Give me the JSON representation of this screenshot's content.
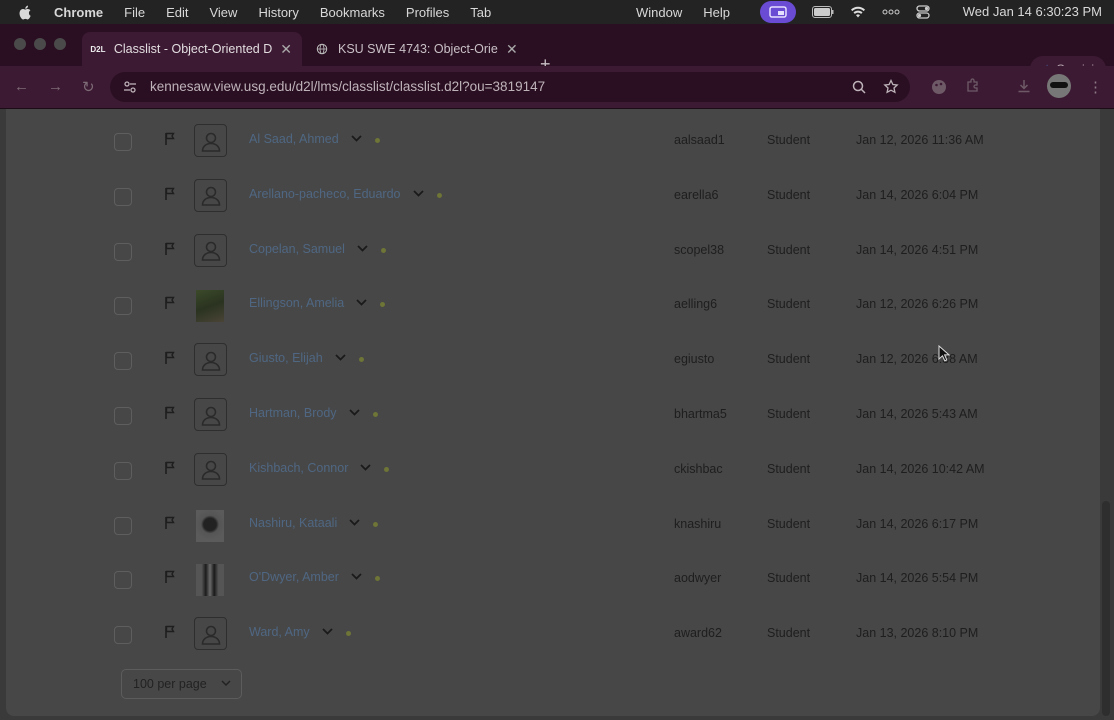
{
  "menubar": {
    "app": "Chrome",
    "items": [
      "File",
      "Edit",
      "View",
      "History",
      "Bookmarks",
      "Profiles",
      "Tab"
    ],
    "right_items": [
      "Window",
      "Help"
    ],
    "clock": "Wed Jan 14  6:30:23 PM"
  },
  "tabs": [
    {
      "label": "Classlist - Object-Oriented D",
      "favicon": "D2L",
      "active": true
    },
    {
      "label": "KSU SWE 4743: Object-Orient",
      "favicon": "globe-icon",
      "active": false
    }
  ],
  "gemini_label": "Gemini",
  "address_bar": {
    "url": "kennesaw.view.usg.edu/d2l/lms/classlist/classlist.d2l?ou=3819147"
  },
  "classlist": {
    "rows": [
      {
        "name": "Al Saad, Ahmed",
        "username": "aalsaad1",
        "role": "Student",
        "last_access": "Jan 12, 2026 11:36 AM",
        "avatar": "default"
      },
      {
        "name": "Arellano-pacheco, Eduardo",
        "username": "earella6",
        "role": "Student",
        "last_access": "Jan 14, 2026 6:04 PM",
        "avatar": "default"
      },
      {
        "name": "Copelan, Samuel",
        "username": "scopel38",
        "role": "Student",
        "last_access": "Jan 14, 2026 4:51 PM",
        "avatar": "default"
      },
      {
        "name": "Ellingson, Amelia",
        "username": "aelling6",
        "role": "Student",
        "last_access": "Jan 12, 2026 6:26 PM",
        "avatar": "photo-green"
      },
      {
        "name": "Giusto, Elijah",
        "username": "egiusto",
        "role": "Student",
        "last_access": "Jan 12, 2026 6:38 AM",
        "avatar": "default"
      },
      {
        "name": "Hartman, Brody",
        "username": "bhartma5",
        "role": "Student",
        "last_access": "Jan 14, 2026 5:43 AM",
        "avatar": "default"
      },
      {
        "name": "Kishbach, Connor",
        "username": "ckishbac",
        "role": "Student",
        "last_access": "Jan 14, 2026 10:42 AM",
        "avatar": "default"
      },
      {
        "name": "Nashiru, Kataali",
        "username": "knashiru",
        "role": "Student",
        "last_access": "Jan 14, 2026 6:17 PM",
        "avatar": "photo-dark"
      },
      {
        "name": "O'Dwyer, Amber",
        "username": "aodwyer",
        "role": "Student",
        "last_access": "Jan 14, 2026 5:54 PM",
        "avatar": "photo-bw"
      },
      {
        "name": "Ward, Amy",
        "username": "award62",
        "role": "Student",
        "last_access": "Jan 13, 2026 8:10 PM",
        "avatar": "default"
      }
    ]
  },
  "pagination": {
    "per_page": "100 per page"
  },
  "colors": {
    "link": "#4f6783",
    "presence_dot": "#6e7536",
    "screen_record": "#6a4bd3"
  }
}
